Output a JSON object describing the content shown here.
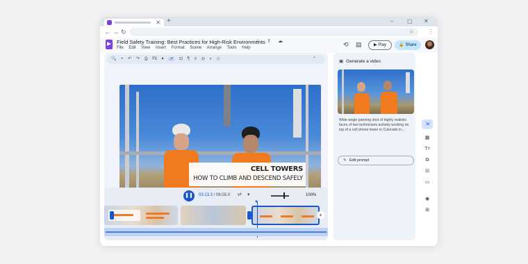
{
  "browser": {
    "new_tab_icon": "+",
    "window_controls": [
      "–",
      "▢",
      "✕"
    ],
    "nav": [
      "←",
      "→",
      "↻"
    ],
    "tab_close": "✕"
  },
  "app": {
    "logo_letter": "▶",
    "doc_title": "Field Safety Training: Best Practices for High-Risk Environments",
    "title_icons": "☆ ⇪ ☁",
    "menus": [
      "File",
      "Edit",
      "View",
      "Insert",
      "Format",
      "Scene",
      "Arrange",
      "Tools",
      "Help"
    ],
    "play_label": "▶  Play",
    "share_label": "🔒 Share",
    "history_icon": "⟲",
    "comment_icon": "▤"
  },
  "toolbar": {
    "items": [
      "🔍",
      "+",
      "↶",
      "↷",
      "⎙",
      "Fit",
      "▾",
      "➚",
      "⊡",
      "¶",
      "≡",
      "◎",
      "◐",
      "◇"
    ],
    "selected_index": 7,
    "collapse_icon": "⌃"
  },
  "video": {
    "caption_line1": "CELL TOWERS",
    "caption_line2": "HOW TO CLIMB AND DESCEND SAFELY"
  },
  "timeline": {
    "play_icon": "❚❚",
    "current_time": "03:13.3",
    "duration": "/ 06:05.0",
    "mode_icon": "⇄",
    "mode_chevron": "▾",
    "zoom": "100%",
    "add_icon": "+",
    "playhead_icon": "▼"
  },
  "generate": {
    "title": "Generate a video",
    "title_icon": "▣",
    "description": "Wide-angle panning shot of highly realistic faces of two technicians actively working on top of a cell phone tower in Colorado in...",
    "edit_prompt": "Edit prompt",
    "edit_icon": "✎"
  },
  "rail": {
    "icons": [
      "⇲",
      "▦",
      "Tт",
      "⧉",
      "⊟",
      "▭",
      "◉",
      "⊞"
    ]
  },
  "colors": {
    "accent": "#1a57c9",
    "brand": "#7b3fe4",
    "safety_vest": "#f07a20"
  }
}
